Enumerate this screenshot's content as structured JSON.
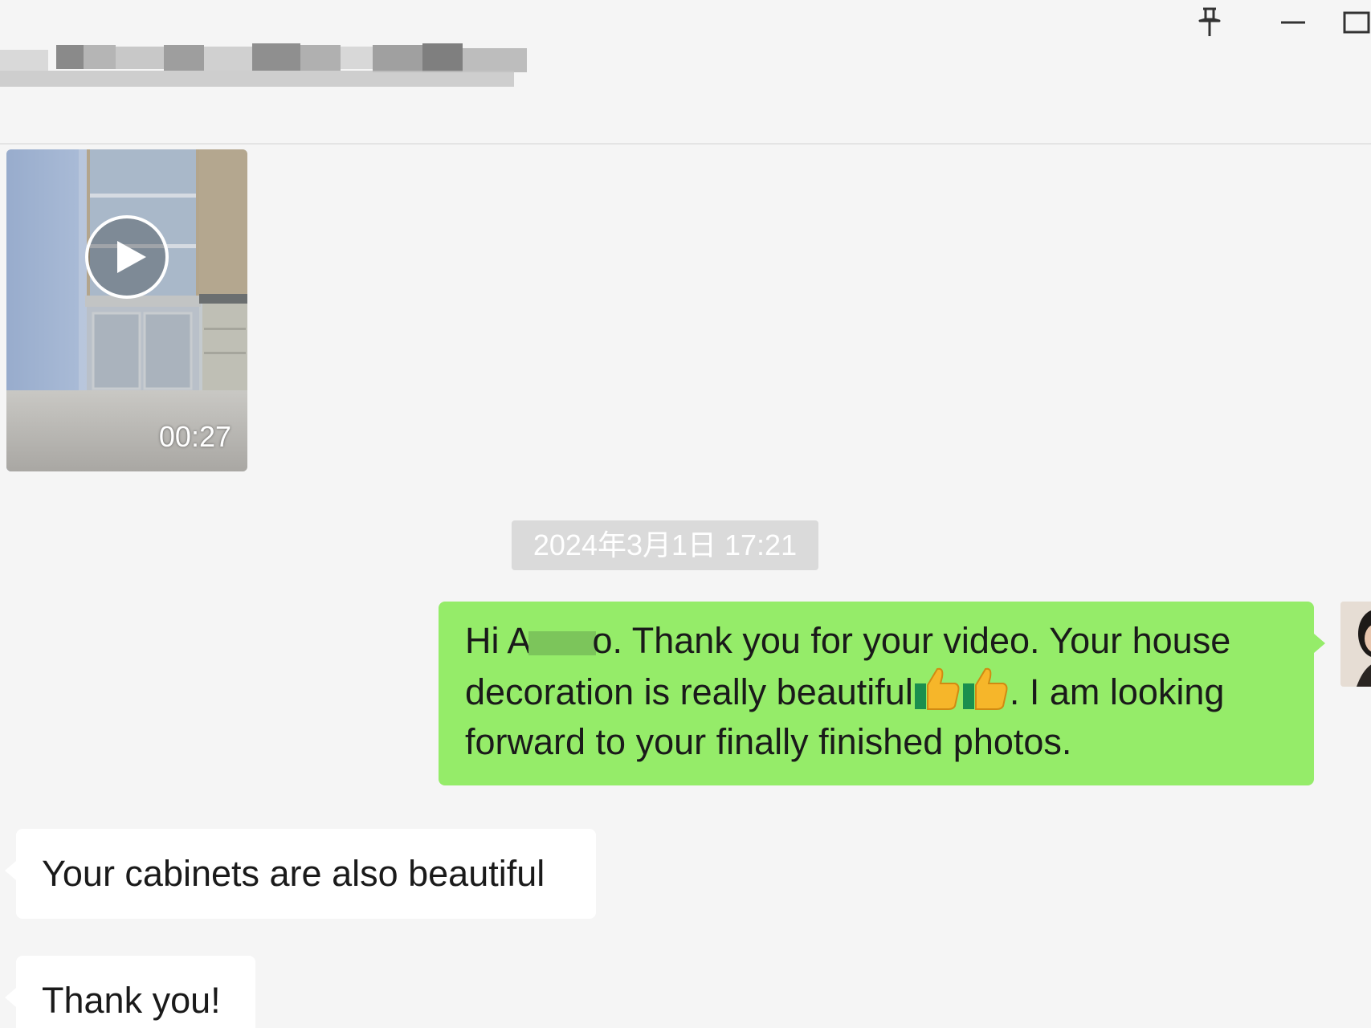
{
  "window": {
    "title": "",
    "controls": {
      "pin_icon": "pin-icon",
      "minimize_icon": "minimize-icon",
      "maximize_icon": "maximize-icon"
    }
  },
  "messages": {
    "video": {
      "duration": "00:27",
      "icon": "play-icon"
    },
    "timestamp": "2024年3月1日 17:21",
    "outgoing": {
      "text_before_name": "Hi A",
      "text_part1": "o. Thank you for your video. Your house decoration is really beautiful",
      "emoji": "thumbs-up",
      "text_part2": ". I am looking forward to your finally finished photos."
    },
    "incoming": [
      {
        "text": "Your cabinets are also beautiful"
      },
      {
        "text": "Thank you!"
      }
    ]
  },
  "colors": {
    "background": "#f5f5f5",
    "outgoing_bubble": "#95ec69",
    "incoming_bubble": "#ffffff",
    "timestamp_bg": "#dadada"
  }
}
